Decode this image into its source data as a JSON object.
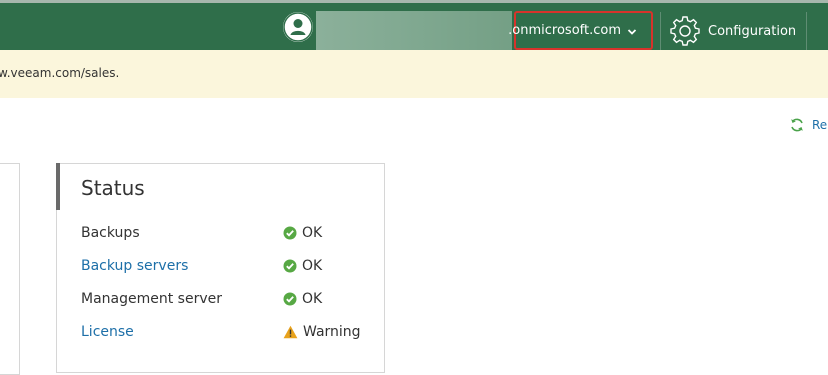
{
  "header": {
    "tenant": ".onmicrosoft.com",
    "configuration_label": "Configuration",
    "icons": {
      "user": "user-avatar-icon",
      "dropdown": "chevron-down-icon",
      "settings": "gear-icon"
    },
    "colors": {
      "bar": "#2f6e4a",
      "highlight_border": "#d8332b"
    }
  },
  "banner": {
    "text": "w.veeam.com/sales.",
    "background": "#fbf6dc"
  },
  "toolbar": {
    "refresh_label": "Re",
    "refresh_icon": "refresh-icon"
  },
  "status": {
    "title": "Status",
    "rows": [
      {
        "label": "Backups",
        "value": "OK",
        "status": "ok",
        "link": false
      },
      {
        "label": "Backup servers",
        "value": "OK",
        "status": "ok",
        "link": true
      },
      {
        "label": "Management server",
        "value": "OK",
        "status": "ok",
        "link": false
      },
      {
        "label": "License",
        "value": "Warning",
        "status": "warning",
        "link": true
      }
    ],
    "colors": {
      "ok": "#57a844",
      "warning": "#e8a21c",
      "link": "#1d6fa8"
    }
  }
}
